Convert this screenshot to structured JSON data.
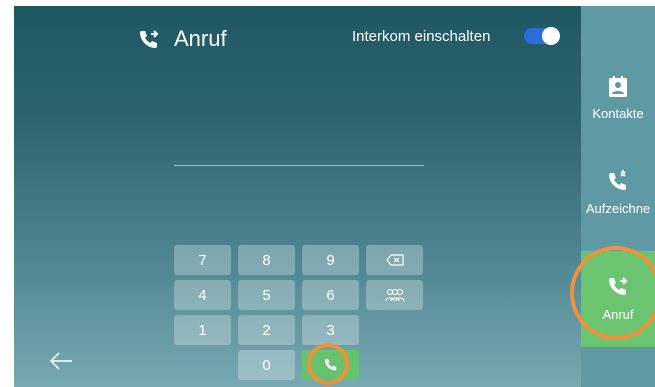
{
  "header": {
    "title": "Anruf",
    "title_icon": "call-forward-icon",
    "intercom_label": "Interkom einschalten",
    "intercom_on": true
  },
  "keypad": {
    "rows": [
      [
        "7",
        "8",
        "9",
        "backspace-icon"
      ],
      [
        "4",
        "5",
        "6",
        "group-icon"
      ],
      [
        "1",
        "2",
        "3"
      ],
      [
        "0",
        "phone-icon"
      ]
    ]
  },
  "sidebar": {
    "items": [
      {
        "label": "Kontakte",
        "icon": "contacts-icon"
      },
      {
        "label": "Aufzeichne",
        "icon": "call-log-icon"
      },
      {
        "label": "Anruf",
        "icon": "call-forward-icon",
        "active": true
      }
    ]
  },
  "colors": {
    "accent_green": "#66c26c",
    "highlight_orange": "#f0913a",
    "toggle_blue": "#2b6fd6"
  }
}
